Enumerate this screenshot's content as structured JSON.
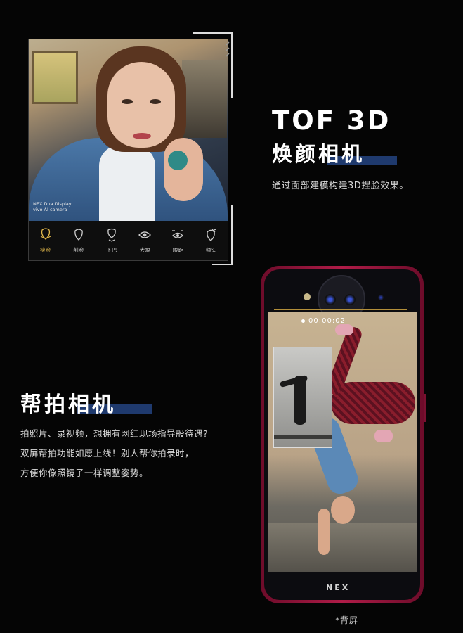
{
  "camera_panel": {
    "caption_line1": "NEX Dua Display",
    "caption_line2": "vivo AI camera",
    "tools": [
      {
        "label": "瘦脸",
        "icon": "slim-face-icon",
        "active": true
      },
      {
        "label": "削脸",
        "icon": "face-contour-icon",
        "active": false
      },
      {
        "label": "下巴",
        "icon": "chin-icon",
        "active": false
      },
      {
        "label": "大眼",
        "icon": "big-eye-icon",
        "active": false
      },
      {
        "label": "眼距",
        "icon": "eye-distance-icon",
        "active": false
      },
      {
        "label": "额头",
        "icon": "forehead-icon",
        "active": false
      }
    ],
    "active_color": "#e2b84b"
  },
  "tof": {
    "title_en": "TOF 3D",
    "title_zh": "焕颜相机",
    "description": "通过面部建模构建3D捏脸效果。",
    "accent_color": "#1f3a6e"
  },
  "helper": {
    "title": "帮拍相机",
    "lines": [
      "拍照片、录视频，想拥有网红现场指导般待遇?",
      "双屏帮拍功能如愿上线！别人帮你拍录时，",
      "方便你像照镜子一样调整姿势。"
    ]
  },
  "phone": {
    "timer": "00:00:02",
    "logo": "NEX",
    "body_color": "#b01c48"
  },
  "footnote": "*背屏"
}
